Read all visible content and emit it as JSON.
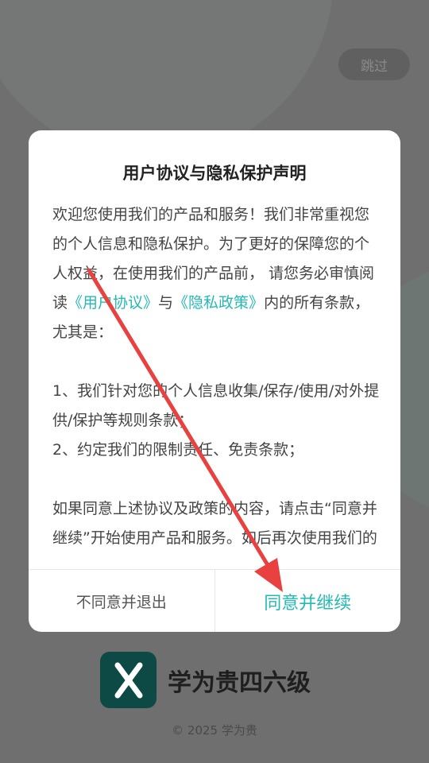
{
  "skip": {
    "label": "跳过"
  },
  "dialog": {
    "title": "用户协议与隐私保护声明",
    "para1": {
      "text_before": "欢迎您使用我们的产品和服务！我们非常重视您的个人信息和隐私保护。为了更好的保障您的个人权益，在使用我们的产品前， 请您务必审慎阅读",
      "link_agreement": "《用户协议》",
      "and_text": "与",
      "link_privacy": "《隐私政策》",
      "text_after": "内的所有条款，尤其是："
    },
    "item1": "1、我们针对您的个人信息收集/保存/使用/对外提供/保护等规则条款；",
    "item2": "2、约定我们的限制责任、免责条款；",
    "para3": "如果同意上述协议及政策的内容，请点击“同意并继续”开始使用产品和服务。如后再次使用我们的产品，即表示您已同意《用户协",
    "decline_label": "不同意并退出",
    "accept_label": "同意并继续"
  },
  "brand": {
    "app_name": "学为贵四六级"
  },
  "copyright": "© 2025 学为贵",
  "colors": {
    "accent": "#23b9b5",
    "arrow": "#e8413f",
    "logo_bg": "#0e4a45"
  }
}
